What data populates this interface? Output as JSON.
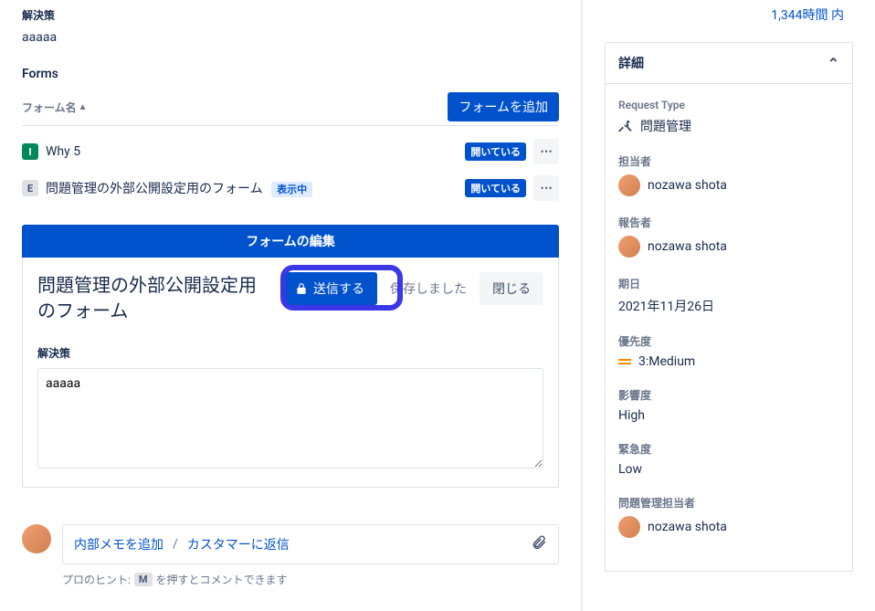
{
  "resolution": {
    "label": "解決策",
    "value": "aaaaa"
  },
  "forms": {
    "heading": "Forms",
    "column_name": "フォーム名",
    "add_button": "フォームを追加",
    "rows": [
      {
        "badge": "I",
        "name": "Why 5",
        "status": "開いている"
      },
      {
        "badge": "E",
        "name": "問題管理の外部公開設定用のフォーム",
        "visibility": "表示中",
        "status": "開いている"
      }
    ]
  },
  "form_editor": {
    "bar_title": "フォームの編集",
    "form_title": "問題管理の外部公開設定用のフォーム",
    "submit_label": "送信する",
    "saved_text": "保存しました",
    "close_label": "閉じる",
    "field_label": "解決策",
    "field_value": "aaaaa"
  },
  "comment": {
    "internal_tab": "内部メモを追加",
    "reply_tab": "カスタマーに返信",
    "hint_prefix": "プロのヒント:",
    "hint_key": "M",
    "hint_suffix": "を押すとコメントできます"
  },
  "sla": {
    "text": "1,344時間 内"
  },
  "details": {
    "header": "詳細",
    "request_type": {
      "label": "Request Type",
      "value": "問題管理"
    },
    "assignee": {
      "label": "担当者",
      "value": "nozawa shota"
    },
    "reporter": {
      "label": "報告者",
      "value": "nozawa shota"
    },
    "due_date": {
      "label": "期日",
      "value": "2021年11月26日"
    },
    "priority": {
      "label": "優先度",
      "value": "3:Medium"
    },
    "impact": {
      "label": "影響度",
      "value": "High"
    },
    "urgency": {
      "label": "緊急度",
      "value": "Low"
    },
    "pm_assignee": {
      "label": "問題管理担当者",
      "value": "nozawa shota"
    }
  }
}
